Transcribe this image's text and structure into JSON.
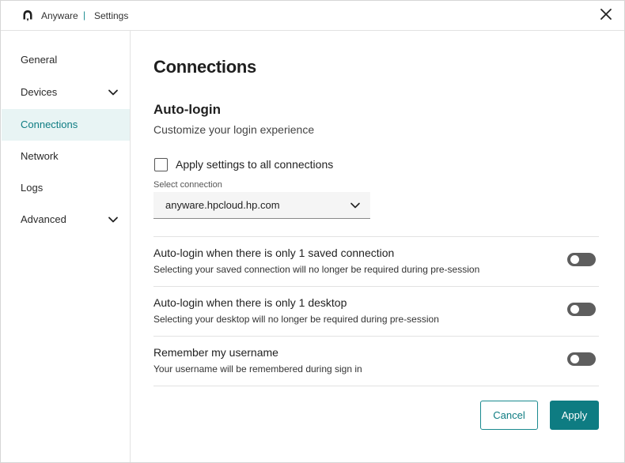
{
  "titlebar": {
    "app_name": "Anyware",
    "separator": "|",
    "title": "Settings",
    "icons": {
      "logo": "anyware-logo-icon",
      "close": "close-icon"
    }
  },
  "sidebar": {
    "items": [
      {
        "label": "General",
        "expandable": false,
        "active": false
      },
      {
        "label": "Devices",
        "expandable": true,
        "active": false
      },
      {
        "label": "Connections",
        "expandable": false,
        "active": true
      },
      {
        "label": "Network",
        "expandable": false,
        "active": false
      },
      {
        "label": "Logs",
        "expandable": false,
        "active": false
      },
      {
        "label": "Advanced",
        "expandable": true,
        "active": false
      }
    ]
  },
  "main": {
    "page_title": "Connections",
    "section_title": "Auto-login",
    "section_subtitle": "Customize your login experience",
    "apply_all": {
      "label": "Apply settings to all connections",
      "checked": false
    },
    "select_connection": {
      "caption": "Select connection",
      "value": "anyware.hpcloud.hp.com"
    },
    "settings": [
      {
        "title": "Auto-login when there is only 1 saved connection",
        "description": "Selecting your saved connection will no longer be required during pre-session",
        "enabled": false
      },
      {
        "title": "Auto-login when there is only 1 desktop",
        "description": "Selecting your desktop will no longer be required during pre-session",
        "enabled": false
      },
      {
        "title": "Remember my username",
        "description": "Your username will be remembered during sign in",
        "enabled": false
      }
    ],
    "buttons": {
      "cancel": "Cancel",
      "apply": "Apply"
    }
  },
  "colors": {
    "accent": "#0e7c82",
    "active_bg": "#e8f4f4",
    "toggle_off": "#5e5e5e",
    "divider": "#e2e2e2"
  }
}
